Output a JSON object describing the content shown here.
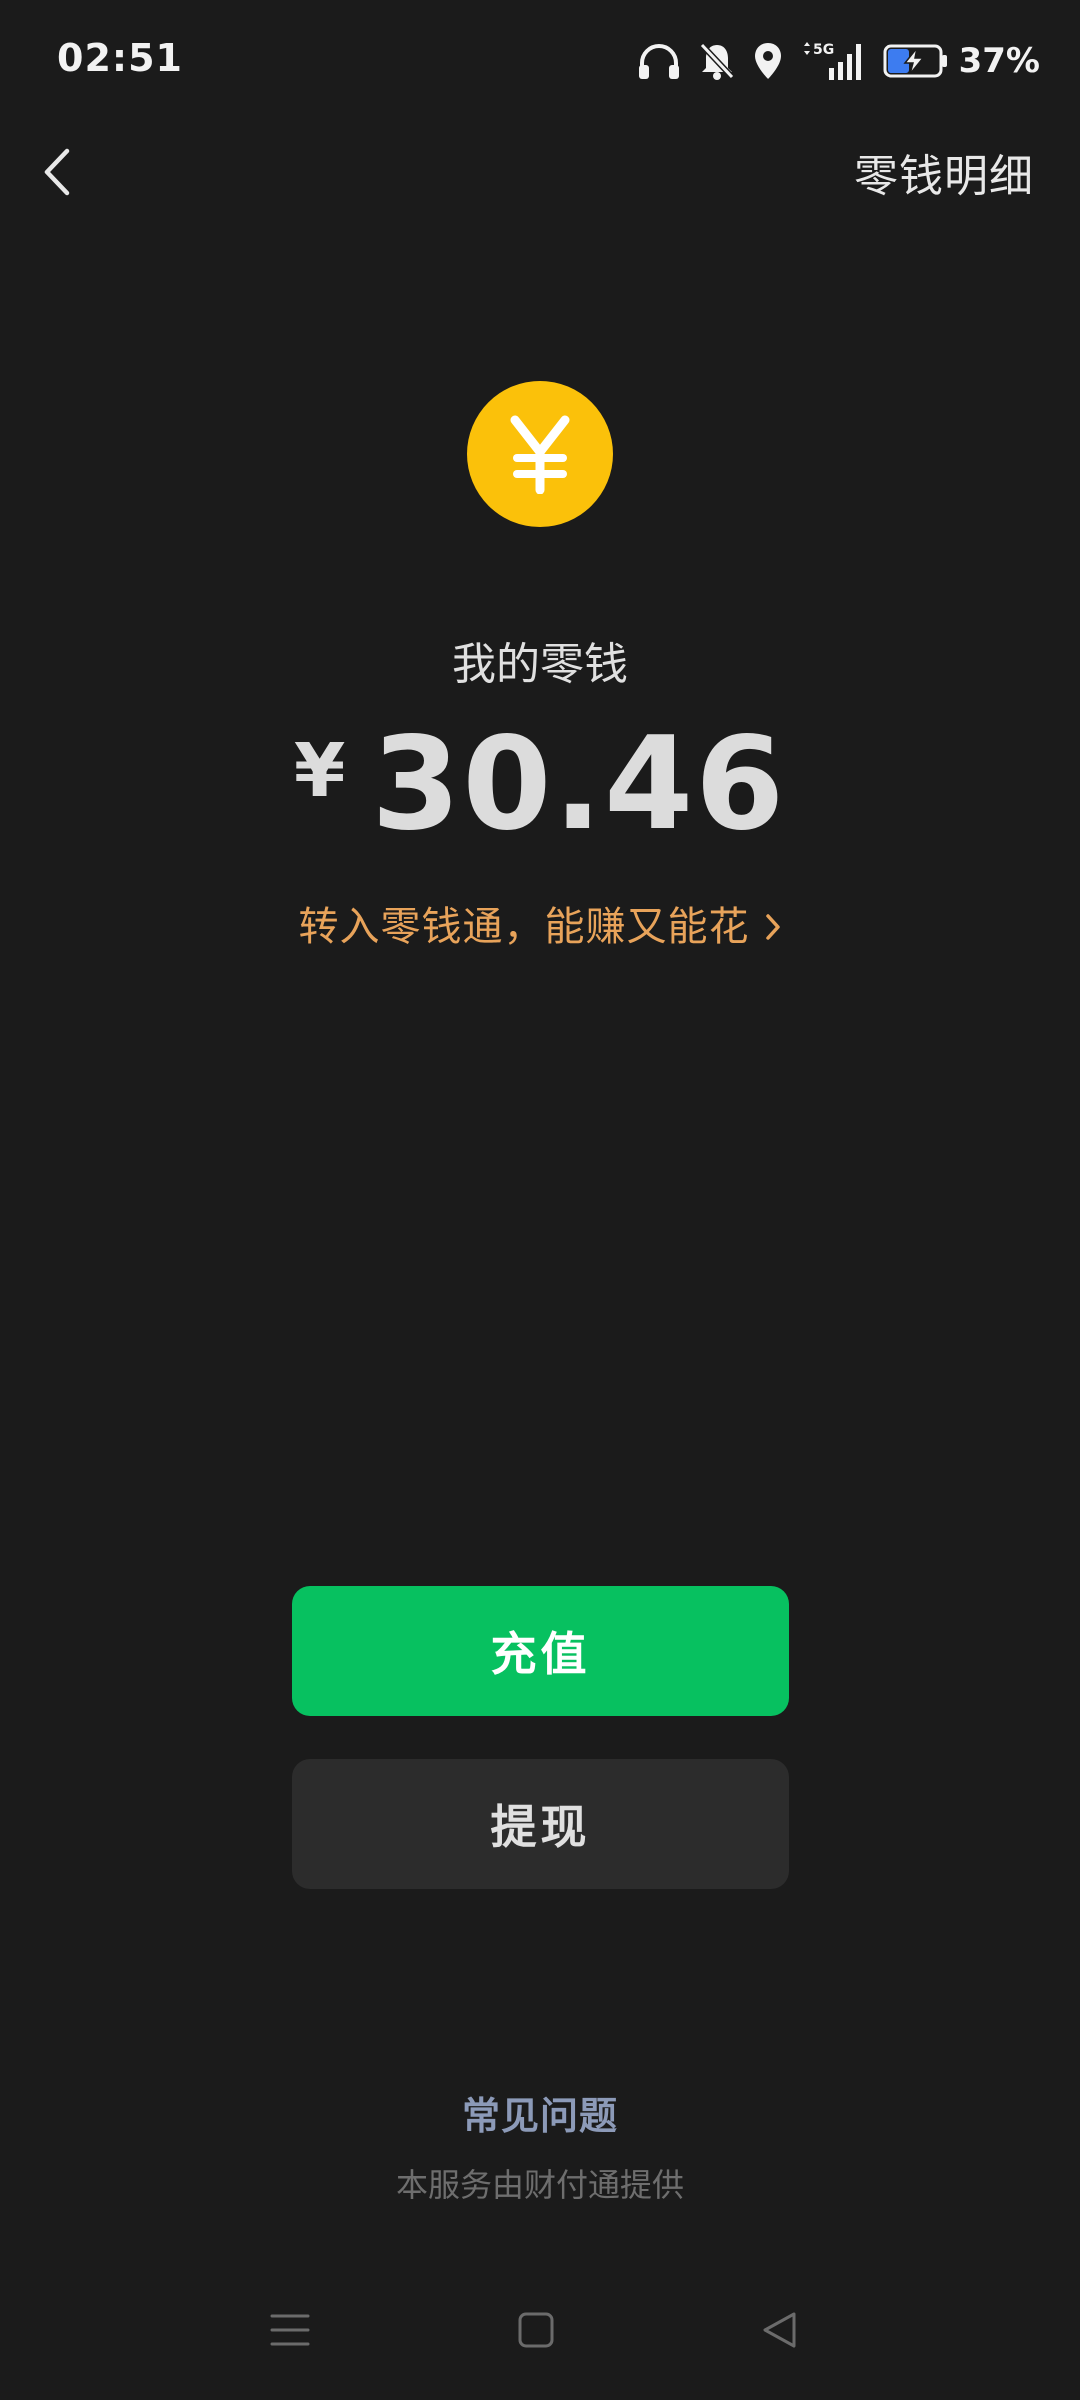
{
  "status_bar": {
    "time": "02:51",
    "network": "5G",
    "battery_percent": "37%",
    "icons": [
      "headphones-icon",
      "bell-muted-icon",
      "location-icon",
      "signal-5g-icon",
      "battery-charging-icon"
    ]
  },
  "nav": {
    "title": "零钱明细",
    "back_icon": "chevron-left-icon"
  },
  "wallet": {
    "coin_symbol": "¥",
    "label": "我的零钱",
    "currency": "¥",
    "amount": "30.46",
    "promo_text": "转入零钱通，能赚又能花",
    "coin_color": "#fbc10a",
    "promo_color": "#e8a35a"
  },
  "actions": {
    "recharge_label": "充值",
    "withdraw_label": "提现",
    "recharge_color": "#07c160",
    "withdraw_color": "#2c2c2c"
  },
  "footer": {
    "faq_label": "常见问题",
    "provider_text": "本服务由财付通提供",
    "faq_color": "#8c9ab8"
  },
  "system_nav": {
    "icons": [
      "menu-icon",
      "home-icon",
      "back-triangle-icon"
    ]
  }
}
